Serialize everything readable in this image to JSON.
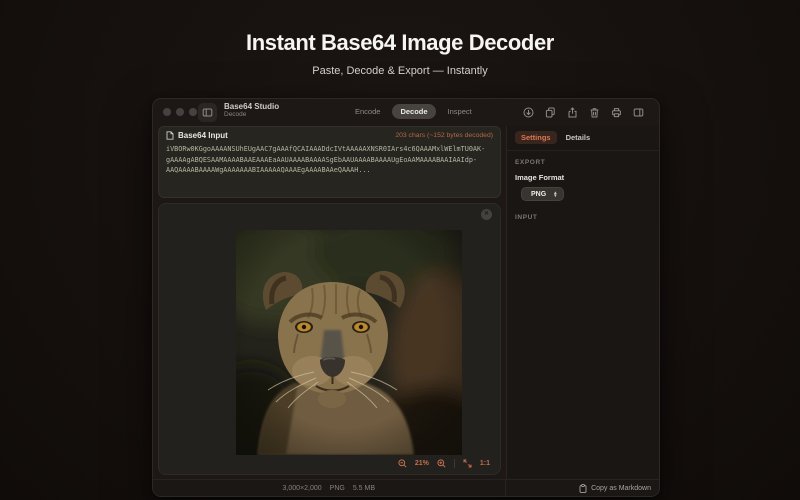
{
  "hero": {
    "title": "Instant Base64 Image Decoder",
    "subtitle": "Paste, Decode & Export — Instantly"
  },
  "window": {
    "titlebar": {
      "app_name": "Base64 Studio",
      "app_mode": "Decode",
      "segments": [
        "Encode",
        "Decode",
        "Inspect"
      ],
      "active_segment": "Decode"
    },
    "input_panel": {
      "title": "Base64 Input",
      "count": "203 chars (~152 bytes decoded)",
      "base64_lines": [
        "iVBORw0KGgoAAAANSUhEUgAAC7gAAAfQCAIAAADdcIVtAAAAAXNSR0IArs4c6QAAAMxlWElmTU0AK-",
        "gAAAAgABQESAAMAAAABAAEAAAEaAAUAAAABAAAASgEbAAUAAAABAAAAUgEoAAMAAAABAAIAAIdp-",
        "AAQAAAABAAAAWgAAAAAAABIAAAAAQAAAEgAAAABAAeQAAAH..."
      ]
    },
    "preview": {
      "zoom_level": "21%",
      "actual_size": "1:1"
    },
    "status_bar": {
      "dimensions": "3,000×2,000",
      "format": "PNG",
      "file_size": "5.5 MB"
    },
    "sidebar": {
      "tabs": [
        "Settings",
        "Details"
      ],
      "active_tab": "Settings",
      "export_section": "EXPORT",
      "image_format_label": "Image Format",
      "image_format_value": "PNG",
      "input_section": "INPUT",
      "copy_markdown": "Copy as Markdown"
    }
  },
  "colors": {
    "accent": "#d97757",
    "zoom_controls": "#c26e4c",
    "count_text": "#b5674a"
  }
}
